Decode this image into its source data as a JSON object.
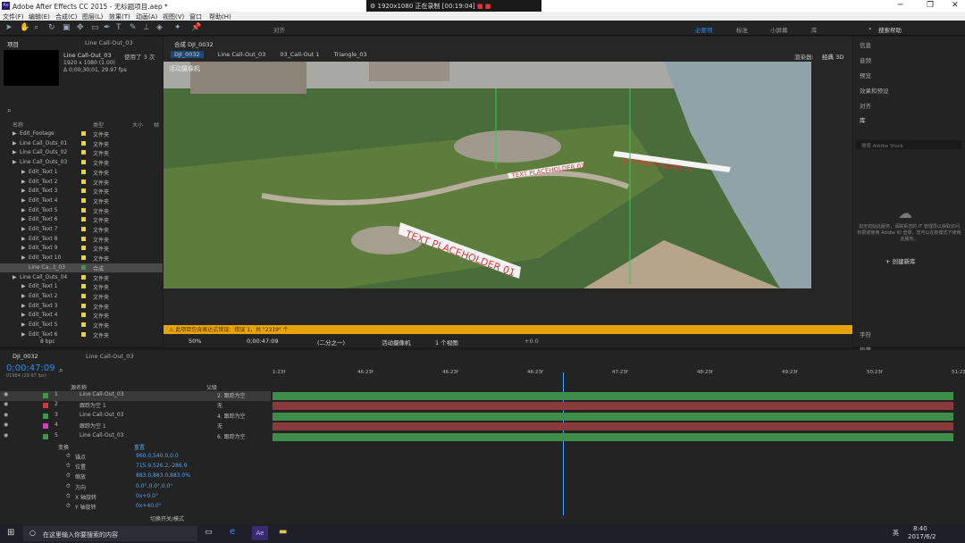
{
  "window": {
    "title": "Adobe After Effects CC 2015 - 无标题项目.aep *",
    "min": "─",
    "max": "❐",
    "close": "✕"
  },
  "recorder": {
    "resolution": "1920x1080",
    "status": "正在录制 [00:19:04]"
  },
  "menu": [
    "文件(F)",
    "编辑(E)",
    "合成(C)",
    "图层(L)",
    "效果(T)",
    "动画(A)",
    "视图(V)",
    "窗口",
    "帮助(H)"
  ],
  "toolbar": {
    "align": "对齐",
    "workspaces": [
      "必要项",
      "标准",
      "小屏幕",
      "库"
    ],
    "search": "搜索帮助"
  },
  "project": {
    "tab": "项目",
    "tab2": "Line Call-Out_03",
    "comp_name": "Line Call-Out_03",
    "used": "使用了 3 次",
    "comp_dims": "1920 x 1080 (1.00)",
    "comp_dur": "Δ 0;00;30;01, 29.97 fps",
    "search_icon": "search-icon",
    "col_name": "名称",
    "col_type": "类型",
    "col_size": "大小",
    "col_frame": "帧",
    "items": [
      {
        "indent": 1,
        "name": "Edit_Footage",
        "type": "文件夹"
      },
      {
        "indent": 1,
        "name": "Line Call_Outs_01",
        "type": "文件夹"
      },
      {
        "indent": 1,
        "name": "Line Call_Outs_02",
        "type": "文件夹"
      },
      {
        "indent": 1,
        "name": "Line Call_Outs_03",
        "type": "文件夹"
      },
      {
        "indent": 2,
        "name": "Edit_Text 1",
        "type": "文件夹"
      },
      {
        "indent": 2,
        "name": "Edit_Text 2",
        "type": "文件夹"
      },
      {
        "indent": 2,
        "name": "Edit_Text 3",
        "type": "文件夹"
      },
      {
        "indent": 2,
        "name": "Edit_Text 4",
        "type": "文件夹"
      },
      {
        "indent": 2,
        "name": "Edit_Text 5",
        "type": "文件夹"
      },
      {
        "indent": 2,
        "name": "Edit_Text 6",
        "type": "文件夹"
      },
      {
        "indent": 2,
        "name": "Edit_Text 7",
        "type": "文件夹"
      },
      {
        "indent": 2,
        "name": "Edit_Text 8",
        "type": "文件夹"
      },
      {
        "indent": 2,
        "name": "Edit_Text 9",
        "type": "文件夹"
      },
      {
        "indent": 2,
        "name": "Edit_Text 10",
        "type": "文件夹"
      },
      {
        "indent": 2,
        "name": "Line Ca...t_03",
        "type": "合成",
        "selected": true
      },
      {
        "indent": 1,
        "name": "Line Call_Outs_04",
        "type": "文件夹"
      },
      {
        "indent": 2,
        "name": "Edit_Text 1",
        "type": "文件夹"
      },
      {
        "indent": 2,
        "name": "Edit_Text 2",
        "type": "文件夹"
      },
      {
        "indent": 2,
        "name": "Edit_Text 3",
        "type": "文件夹"
      },
      {
        "indent": 2,
        "name": "Edit_Text 4",
        "type": "文件夹"
      },
      {
        "indent": 2,
        "name": "Edit_Text 5",
        "type": "文件夹"
      },
      {
        "indent": 2,
        "name": "Edit_Text 6",
        "type": "文件夹"
      }
    ],
    "bpc": "8 bpc"
  },
  "viewer": {
    "tab": "合成 DJI_0032",
    "crumbs": [
      "DJI_0032",
      "Line Call-Out_03",
      "03_Call-Out 1",
      "Triangle_03"
    ],
    "renderer": "渲染器:",
    "renderer_val": "经典 3D",
    "camera_label": "活动摄像机",
    "callout_text": "TEXT PLACEHOLDER 01",
    "warning": "此项目包含表达式错误：错误 1，共 \"2319\" 个",
    "zoom": "50%",
    "time": "0;00:47:09",
    "res": "(二分之一)",
    "cam": "活动摄像机",
    "views": "1 个视图",
    "exposure": "+0.0"
  },
  "right": {
    "items": [
      "信息",
      "音频",
      "预览",
      "效果和预设",
      "对齐"
    ],
    "lib": "库",
    "lib_search": "搜索 Adobe Stock",
    "lib_msg": "如无初始此服务，请联系您的 IT 管理员以获取访问权限或使用 Adobe ID 登录，您可以在新模式下使用此服务。",
    "create": "+ 创建新库",
    "char": "字符",
    "para": "段落"
  },
  "timeline": {
    "tab": "DJI_0032",
    "tab2": "Line Call-Out_03",
    "timecode": "0;00:47:09",
    "frames": "01984 (29.97 fps)",
    "col_source": "源名称",
    "col_parent": "父级",
    "ruler": [
      "1:23f",
      "46:23f",
      "46:23f",
      "46:23f",
      "47:23f",
      "48:23f",
      "49:23f",
      "50:23f",
      "51:23f"
    ],
    "layers": [
      {
        "num": "1",
        "name": "Line Call-Out_03",
        "parent": "2. 跟踪为空",
        "color": "#3a9a4a",
        "bar": "#3e8d4a"
      },
      {
        "num": "2",
        "name": "跟踪为空 1",
        "parent": "无",
        "color": "#cc3a3a",
        "bar": "#8a3a3a"
      },
      {
        "num": "3",
        "name": "Line Call-Out_03",
        "parent": "4. 跟踪为空",
        "color": "#3a9a4a",
        "bar": "#3e8d4a"
      },
      {
        "num": "4",
        "name": "跟踪为空 1",
        "parent": "无",
        "color": "#d040c0",
        "bar": "#8a3a3a"
      },
      {
        "num": "5",
        "name": "Line Call-Out_03",
        "parent": "6. 跟踪为空",
        "color": "#3a9a4a",
        "bar": "#3e8d4a"
      }
    ],
    "transform": "变换",
    "reset": "重置",
    "props": [
      {
        "name": "锚点",
        "val": "960.0,540.0,0.0"
      },
      {
        "name": "位置",
        "val": "715.9,526.2,-286.9"
      },
      {
        "name": "缩放",
        "val": "883.0,883.0,883.0%"
      },
      {
        "name": "方向",
        "val": "0.0°,0.0°,0.0°"
      },
      {
        "name": "X 轴旋转",
        "val": "0x+0.0°"
      },
      {
        "name": "Y 轴旋转",
        "val": "0x+40.0°"
      }
    ],
    "switch": "切换开关/模式"
  },
  "taskbar": {
    "search": "在这里输入你要搜索的内容",
    "time": "8:40",
    "date": "2017/6/2",
    "lang": "英"
  },
  "colors": {
    "accent": "#2d8ceb",
    "warn": "#e6a40a"
  }
}
